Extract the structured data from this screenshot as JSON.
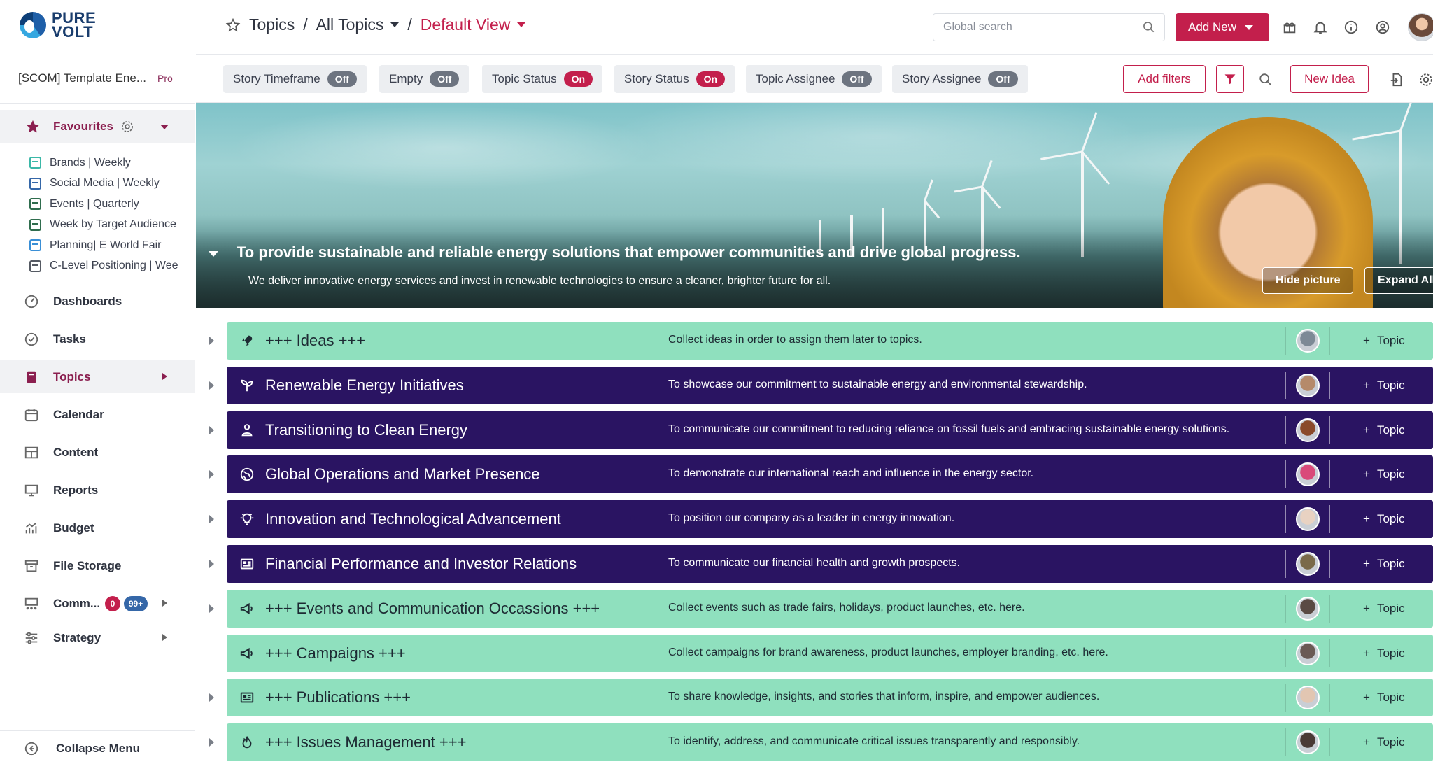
{
  "logo": {
    "line1": "PURE",
    "line2": "VOLT"
  },
  "workspace": {
    "name": "[SCOM] Template Ene...",
    "plan": "Pro"
  },
  "favourites": {
    "label": "Favourites",
    "items": [
      {
        "label": "Brands | Weekly",
        "color": "#3bb8a8"
      },
      {
        "label": "Social Media | Weekly",
        "color": "#3567a8"
      },
      {
        "label": "Events | Quarterly",
        "color": "#2f6d4e"
      },
      {
        "label": "Week by Target Audience",
        "color": "#2f6d4e"
      },
      {
        "label": "Planning| E World Fair",
        "color": "#3a8fd6"
      },
      {
        "label": "C-Level Positioning | Wee",
        "color": "#555a63"
      }
    ]
  },
  "nav": [
    {
      "label": "Dashboards",
      "icon": "gauge-icon"
    },
    {
      "label": "Tasks",
      "icon": "check-circle-icon"
    },
    {
      "label": "Topics",
      "icon": "book-icon",
      "active": true
    },
    {
      "label": "Calendar",
      "icon": "calendar-icon"
    },
    {
      "label": "Content",
      "icon": "grid-icon"
    },
    {
      "label": "Reports",
      "icon": "monitor-icon"
    },
    {
      "label": "Budget",
      "icon": "chart-up-icon"
    },
    {
      "label": "File Storage",
      "icon": "archive-icon"
    },
    {
      "label": "Comm...",
      "icon": "community-icon",
      "badge_red": "0",
      "badge_blue": "99+"
    },
    {
      "label": "Strategy",
      "icon": "sliders-icon"
    }
  ],
  "collapse_label": "Collapse Menu",
  "breadcrumb": {
    "root": "Topics",
    "level2": "All Topics",
    "view": "Default View"
  },
  "search": {
    "placeholder": "Global search"
  },
  "add_new_label": "Add New",
  "filters": [
    {
      "label": "Story Timeframe",
      "state": "Off"
    },
    {
      "label": "Empty",
      "state": "Off"
    },
    {
      "label": "Topic Status",
      "state": "On"
    },
    {
      "label": "Story Status",
      "state": "On"
    },
    {
      "label": "Topic Assignee",
      "state": "Off"
    },
    {
      "label": "Story Assignee",
      "state": "Off"
    }
  ],
  "add_filters_label": "Add filters",
  "new_idea_label": "New Idea",
  "hero": {
    "title": "To provide sustainable and reliable energy solutions that empower communities and drive global progress.",
    "subtitle": "We deliver innovative energy services and invest in renewable technologies to ensure a cleaner, brighter future for all.",
    "hide_picture": "Hide picture",
    "expand_all": "Expand All"
  },
  "topics": [
    {
      "title": "+++ Ideas +++",
      "desc": "Collect ideas in order to assign them later to topics.",
      "style": "light",
      "icon": "rocket-icon",
      "action": "Topic",
      "avatar": "#7d8a96"
    },
    {
      "title": "Renewable Energy Initiatives",
      "desc": "To showcase our commitment to sustainable energy and environmental stewardship.",
      "style": "dark",
      "icon": "sprout-icon",
      "action": "Topic",
      "avatar": "#b58a6a"
    },
    {
      "title": "Transitioning to Clean Energy",
      "desc": "To communicate our commitment to reducing reliance on fossil fuels and embracing sustainable energy solutions.",
      "style": "dark",
      "icon": "eco-person-icon",
      "action": "Topic",
      "avatar": "#8a4a2a"
    },
    {
      "title": "Global Operations and Market Presence",
      "desc": "To demonstrate our international reach and influence in the energy sector.",
      "style": "dark",
      "icon": "globe-icon",
      "action": "Topic",
      "avatar": "#d94a7a"
    },
    {
      "title": "Innovation and Technological Advancement",
      "desc": "To position our company as a leader in energy innovation.",
      "style": "dark",
      "icon": "lightbulb-icon",
      "action": "Topic",
      "avatar": "#e8d2c2"
    },
    {
      "title": "Financial Performance and Investor Relations",
      "desc": "To communicate our financial health and growth prospects.",
      "style": "dark",
      "icon": "newspaper-icon",
      "action": "Topic",
      "avatar": "#7a6a4a"
    },
    {
      "title": "+++ Events and Communication Occassions +++",
      "desc": "Collect events such as trade fairs, holidays, product launches, etc. here.",
      "style": "light",
      "icon": "megaphone-icon",
      "action": "Topic",
      "avatar": "#5a4a44"
    },
    {
      "title": "+++ Campaigns +++",
      "desc": "Collect campaigns for brand awareness, product launches, employer branding, etc. here.",
      "style": "light",
      "icon": "megaphone-icon",
      "action": "Topic",
      "avatar": "#6a5a55"
    },
    {
      "title": "+++ Publications +++",
      "desc": "To share knowledge, insights, and stories that inform, inspire, and empower audiences.",
      "style": "light",
      "icon": "newspaper-icon",
      "action": "Topic",
      "avatar": "#e2c6b2"
    },
    {
      "title": "+++ Issues Management +++",
      "desc": "To identify, address, and communicate critical issues transparently and responsibly.",
      "style": "light",
      "icon": "flame-icon",
      "action": "Topic",
      "avatar": "#4a3a36"
    }
  ]
}
